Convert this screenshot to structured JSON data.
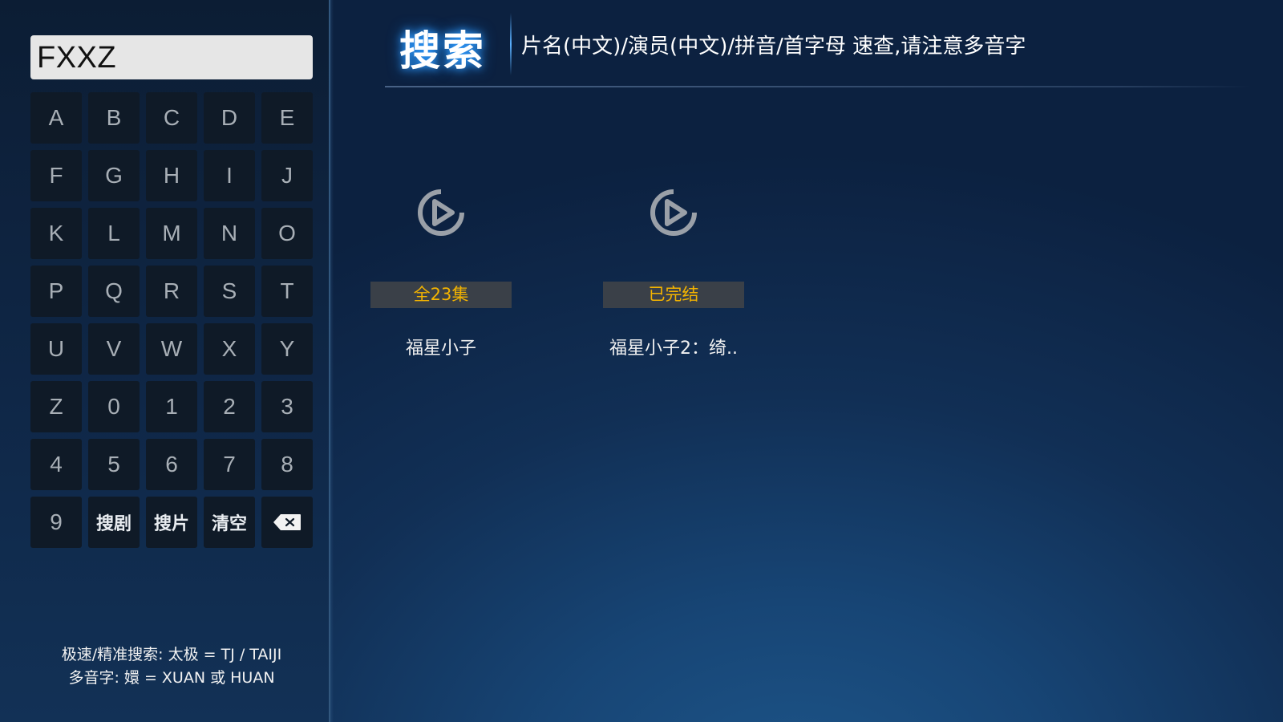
{
  "search": {
    "query": "FXXZ"
  },
  "keyboard": {
    "keys": [
      "A",
      "B",
      "C",
      "D",
      "E",
      "F",
      "G",
      "H",
      "I",
      "J",
      "K",
      "L",
      "M",
      "N",
      "O",
      "P",
      "Q",
      "R",
      "S",
      "T",
      "U",
      "V",
      "W",
      "X",
      "Y",
      "Z",
      "0",
      "1",
      "2",
      "3",
      "4",
      "5",
      "6",
      "7",
      "8",
      "9"
    ],
    "search_series_label": "搜剧",
    "search_movie_label": "搜片",
    "clear_label": "清空",
    "backspace_icon": "backspace-icon"
  },
  "hint": {
    "line1": "极速/精准搜索: 太极 = TJ / TAIJI",
    "line2": "多音字: 嬛 = XUAN 或 HUAN"
  },
  "header": {
    "title": "搜索",
    "hint": "片名(中文)/演员(中文)/拼音/首字母 速查,请注意多音字"
  },
  "results": [
    {
      "badge": "全23集",
      "title": "福星小子",
      "icon": "play-icon"
    },
    {
      "badge": "已完结",
      "title": "福星小子2：绮..",
      "icon": "play-icon"
    }
  ],
  "colors": {
    "badge_text": "#f4b400",
    "title_glow": "#2f9cff",
    "key_background": "#0f1a27"
  }
}
